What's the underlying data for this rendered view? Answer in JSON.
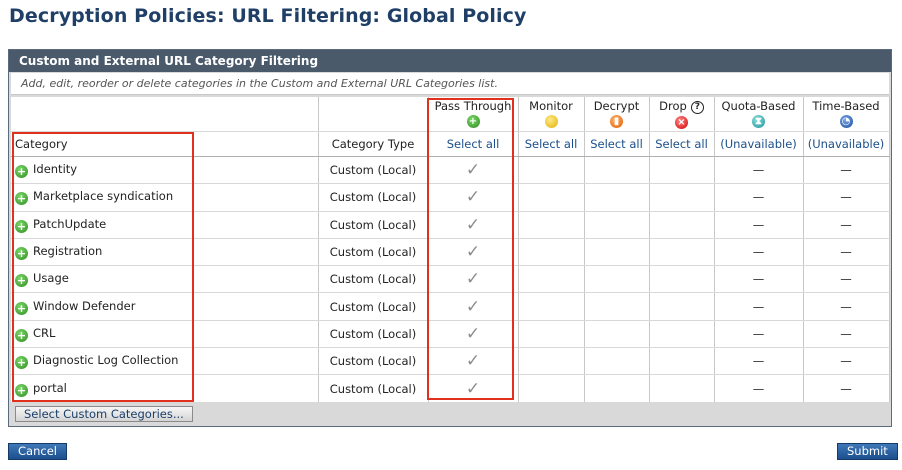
{
  "page": {
    "title": "Decryption Policies: URL Filtering: Global Policy"
  },
  "panel": {
    "header": "Custom and External URL Category Filtering",
    "description": "Add, edit, reorder or delete categories in the Custom and External URL Categories list."
  },
  "columns": {
    "category": "Category",
    "category_type": "Category Type",
    "pass_through": "Pass Through",
    "monitor": "Monitor",
    "decrypt": "Decrypt",
    "drop": "Drop",
    "quota_based": "Quota-Based",
    "time_based": "Time-Based"
  },
  "select_row": {
    "pass_through": "Select all",
    "monitor": "Select all",
    "decrypt": "Select all",
    "drop": "Select all",
    "quota_based": "(Unavailable)",
    "time_based": "(Unavailable)"
  },
  "icons": {
    "pass_through": "green-plus-icon",
    "monitor": "yellow-circle-icon",
    "decrypt": "orange-lock-icon",
    "drop": "red-x-icon",
    "quota_based": "teal-hourglass-icon",
    "time_based": "blue-clock-icon",
    "help": "help-icon"
  },
  "rows": [
    {
      "name": "Identity",
      "type": "Custom (Local)",
      "pass_through": "✓",
      "quota": "—",
      "time": "—"
    },
    {
      "name": "Marketplace syndication",
      "type": "Custom (Local)",
      "pass_through": "✓",
      "quota": "—",
      "time": "—"
    },
    {
      "name": "PatchUpdate",
      "type": "Custom (Local)",
      "pass_through": "✓",
      "quota": "—",
      "time": "—"
    },
    {
      "name": "Registration",
      "type": "Custom (Local)",
      "pass_through": "✓",
      "quota": "—",
      "time": "—"
    },
    {
      "name": "Usage",
      "type": "Custom (Local)",
      "pass_through": "✓",
      "quota": "—",
      "time": "—"
    },
    {
      "name": "Window Defender",
      "type": "Custom (Local)",
      "pass_through": "✓",
      "quota": "—",
      "time": "—"
    },
    {
      "name": "CRL",
      "type": "Custom (Local)",
      "pass_through": "✓",
      "quota": "—",
      "time": "—"
    },
    {
      "name": "Diagnostic Log Collection",
      "type": "Custom (Local)",
      "pass_through": "✓",
      "quota": "—",
      "time": "—"
    },
    {
      "name": "portal",
      "type": "Custom (Local)",
      "pass_through": "✓",
      "quota": "—",
      "time": "—"
    }
  ],
  "buttons": {
    "select_custom": "Select Custom Categories...",
    "cancel": "Cancel",
    "submit": "Submit"
  },
  "colors": {
    "highlight": "#e0301e",
    "header_bg": "#4a5a6b",
    "title": "#1f3f66"
  }
}
